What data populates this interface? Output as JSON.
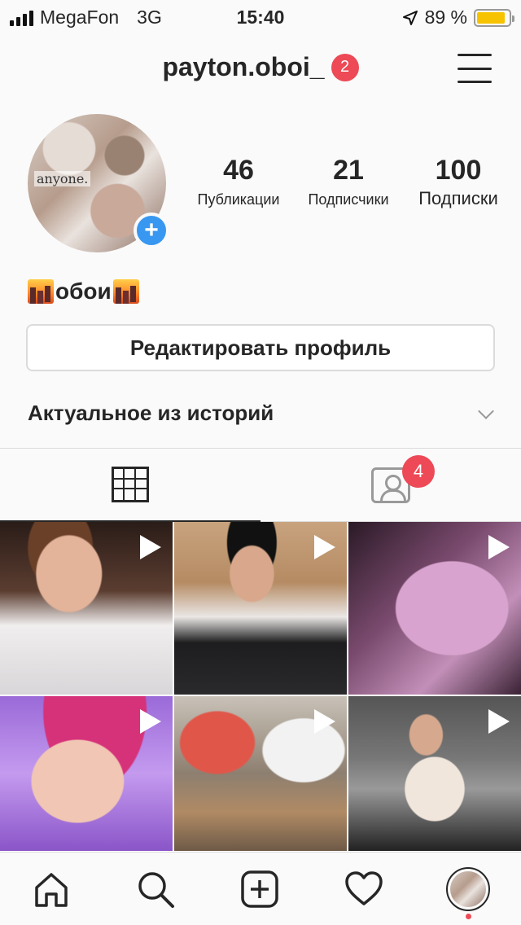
{
  "status_bar": {
    "carrier": "MegaFon",
    "network": "3G",
    "time": "15:40",
    "battery_percent": "89 %",
    "battery_level": 0.89,
    "battery_color": "#f7c300"
  },
  "header": {
    "username": "payton.oboi_",
    "notification_count": "2",
    "menu_icon": "hamburger-menu-icon"
  },
  "profile": {
    "stats": [
      {
        "value": "46",
        "label": "Публикации"
      },
      {
        "value": "21",
        "label": "Подписчики"
      },
      {
        "value": "100",
        "label": "Подписки"
      }
    ],
    "bio_text": "обои",
    "bio_emoji": "city-dusk-emoji",
    "edit_button_label": "Редактировать профиль",
    "highlights_label": "Актуальное из историй"
  },
  "tabs": {
    "grid_icon": "grid-icon",
    "tagged_icon": "tagged-person-icon",
    "tagged_badge": "4"
  },
  "photos": [
    {
      "type": "video"
    },
    {
      "type": "video"
    },
    {
      "type": "video"
    },
    {
      "type": "video"
    },
    {
      "type": "video"
    },
    {
      "type": "video"
    }
  ],
  "bottom_nav": [
    "home-icon",
    "search-icon",
    "add-post-icon",
    "heart-icon",
    "profile-avatar"
  ],
  "colors": {
    "badge": "#ed4956",
    "accent": "#3897f0",
    "text": "#262626",
    "border": "#dbdbdb"
  }
}
